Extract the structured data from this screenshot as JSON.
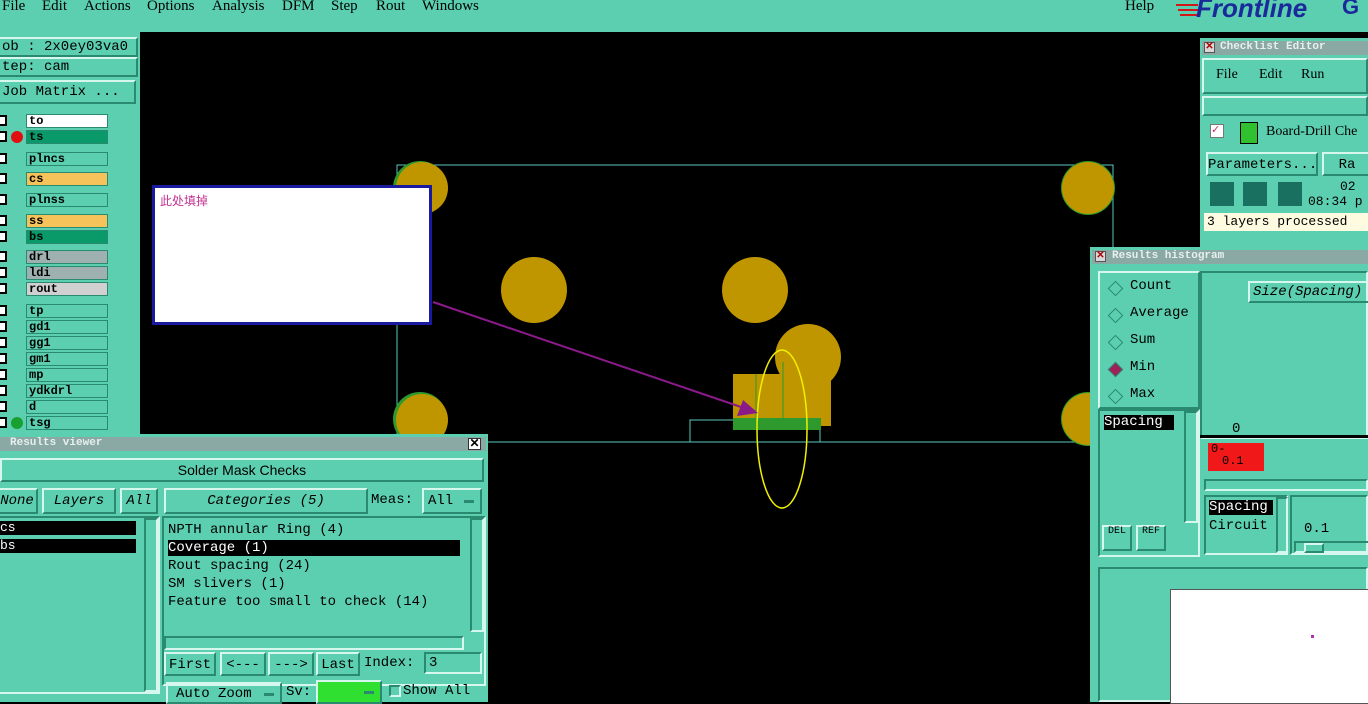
{
  "menu": {
    "items": [
      "File",
      "Edit",
      "Actions",
      "Options",
      "Analysis",
      "DFM",
      "Step",
      "Rout",
      "Windows"
    ],
    "help": "Help"
  },
  "logo": {
    "text": "Frontline",
    "suffix": "G"
  },
  "job": {
    "job_label": "ob : 2x0ey03va0",
    "step_label": "tep: cam",
    "matrix_button": "Job Matrix ..."
  },
  "layers": [
    {
      "name": "to",
      "bg": "#ffffff",
      "dot": null
    },
    {
      "name": "ts",
      "bg": "#0a9a6a",
      "dot": "#e01010"
    },
    {
      "name": "plncs",
      "bg": "#5ccfb0",
      "dot": null
    },
    {
      "name": "cs",
      "bg": "#f5c35a",
      "dot": null
    },
    {
      "name": "plnss",
      "bg": "#5ccfb0",
      "dot": null
    },
    {
      "name": "ss",
      "bg": "#f5c35a",
      "dot": null
    },
    {
      "name": "bs",
      "bg": "#0a9a6a",
      "dot": null
    },
    {
      "name": "drl",
      "bg": "#9fb0b0",
      "dot": null
    },
    {
      "name": "ldi",
      "bg": "#9fb0b0",
      "dot": null
    },
    {
      "name": "rout",
      "bg": "#d0d0d0",
      "dot": null
    },
    {
      "name": "tp",
      "bg": "#5ccfb0",
      "dot": null
    },
    {
      "name": "gd1",
      "bg": "#5ccfb0",
      "dot": null
    },
    {
      "name": "gg1",
      "bg": "#5ccfb0",
      "dot": null
    },
    {
      "name": "gm1",
      "bg": "#5ccfb0",
      "dot": null
    },
    {
      "name": "mp",
      "bg": "#5ccfb0",
      "dot": null
    },
    {
      "name": "ydkdrl",
      "bg": "#5ccfb0",
      "dot": null
    },
    {
      "name": "d",
      "bg": "#5ccfb0",
      "dot": null
    },
    {
      "name": "tsg",
      "bg": "#5ccfb0",
      "dot": "#18a030"
    }
  ],
  "annotation": {
    "text": "此处填掉"
  },
  "results_viewer": {
    "title": "Results viewer",
    "header": "Solder Mask Checks",
    "none_button": "None",
    "layers_label": "Layers",
    "all_button": "All",
    "layer_items": [
      "cs",
      "bs"
    ],
    "categories_label": "Categories (5)",
    "meas_label": "Meas:",
    "meas_value": "All",
    "categories": [
      {
        "label": "NPTH annular Ring (4)",
        "selected": false
      },
      {
        "label": "Coverage (1)",
        "selected": true
      },
      {
        "label": "Rout spacing (24)",
        "selected": false
      },
      {
        "label": "SM slivers (1)",
        "selected": false
      },
      {
        "label": "Feature too small to check (14)",
        "selected": false
      }
    ],
    "first_button": "First",
    "prev_button": "<---",
    "next_button": "--->",
    "last_button": "Last",
    "index_label": "Index:",
    "index_value": "3",
    "auto_zoom_label": "Auto Zoom",
    "sv_label": "Sv:",
    "show_all_label": "Show All"
  },
  "checklist_editor": {
    "title": "Checklist Editor",
    "menu": [
      "File",
      "Edit",
      "Run"
    ],
    "item_label": "Board-Drill Che",
    "params_button": "Parameters...",
    "ra_button": "Ra",
    "time_line1": "02",
    "time_line2": "08:34 p",
    "status": "3 layers processed"
  },
  "histogram": {
    "title": "Results histogram",
    "options": [
      {
        "label": "Count",
        "selected": false
      },
      {
        "label": "Average",
        "selected": false
      },
      {
        "label": "Sum",
        "selected": false
      },
      {
        "label": "Min",
        "selected": true
      },
      {
        "label": "Max",
        "selected": false
      }
    ],
    "size_label": "Size(Spacing)",
    "spacing_item": "Spacing",
    "axis_zero": "0",
    "bar_label_top": "0-",
    "bar_label_bottom": "0.1",
    "del_button": "DEL",
    "ref_button": "REF",
    "list2": [
      "Spacing",
      "Circuit"
    ],
    "value": "0.1"
  },
  "colors": {
    "panel": "#5ccfb0",
    "pad": "#bf9600",
    "green_layer": "#2e9a2e",
    "outline": "#5cc8c0",
    "arrow": "#8a1a8a",
    "ellipse": "#f0f000"
  }
}
